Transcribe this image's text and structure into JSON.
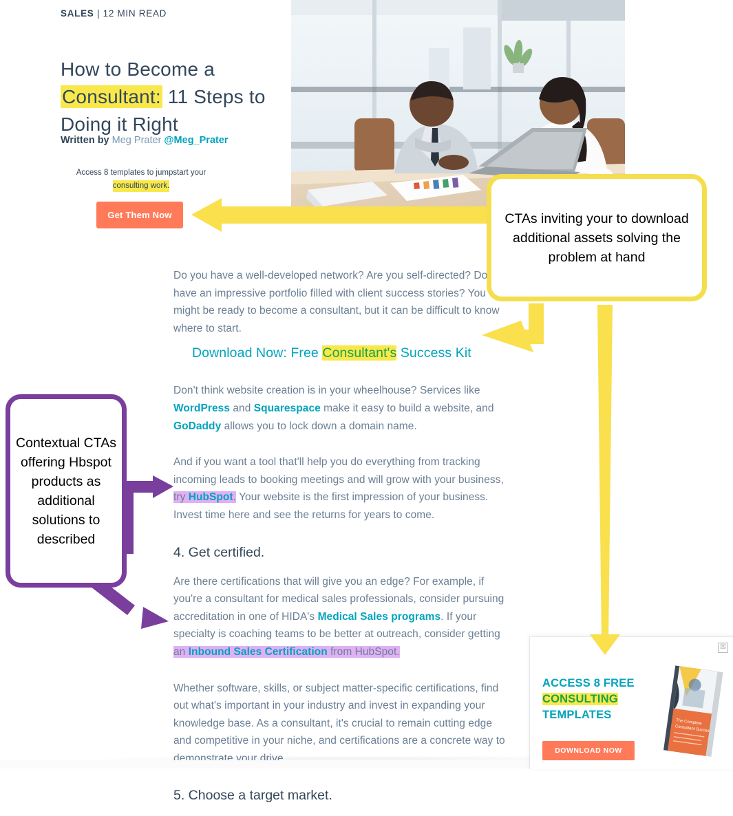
{
  "article": {
    "kicker_category": "SALES",
    "kicker_sep": " | ",
    "kicker_read": "12 MIN READ",
    "title_line1": "How to Become a",
    "title_highlight": "Consultant:",
    "title_line2_rest": " 11 Steps to",
    "title_line3": "Doing it Right",
    "byline_prefix": "Written by",
    "byline_author": "Meg Prater",
    "byline_handle": "@Meg_Prater"
  },
  "inline_cta": {
    "line1": "Access 8 templates to jumpstart your",
    "line2_highlighted": "consulting work.",
    "button_label": "Get Them Now"
  },
  "hero": {
    "alt": "Two business colleagues reviewing a laptop at a conference table in a bright office"
  },
  "body": {
    "p1": "Do you have a well-developed network? Are you self-directed? Do you have an impressive portfolio filled with client success stories? You might be ready to become a consultant, but it can be difficult to know where to start.",
    "cta_link_pre": "Download Now: Free ",
    "cta_link_highlight": "Consultant's",
    "cta_link_post": " Success Kit",
    "p2_a": "Don't think website creation is in your wheelhouse? Services like ",
    "p2_link1": "WordPress",
    "p2_b": " and ",
    "p2_link2": "Squarespace",
    "p2_c": " make it easy to build a website, and ",
    "p2_link3": "GoDaddy",
    "p2_d": " allows you to lock down a domain name.",
    "p3_a": "And if you want a tool that'll help you do everything from tracking incoming leads to booking meetings and will grow with your business, ",
    "p3_hl_pre": "try ",
    "p3_hl_link": "HubSpot",
    "p3_hl_post": ".",
    "p3_b": " Your website is the first impression of your business. Invest time here and see the returns for years to come.",
    "h4": "4. Get certified.",
    "p4_a": "Are there certifications that will give you an edge? For example, if you're a consultant for medical sales professionals, consider pursuing accreditation in one of HIDA's ",
    "p4_link1": "Medical Sales programs",
    "p4_b": ". If your specialty is coaching teams to be better at outreach, consider getting ",
    "p4_hl_pre": "an ",
    "p4_hl_link": "Inbound Sales Certification",
    "p4_hl_post": " from HubSpot.",
    "p5": "Whether software, skills, or subject matter-specific certifications, find out what's important in your industry and invest in expanding your knowledge base. As a consultant, it's crucial to remain cutting edge and competitive in your niche, and certifications are a concrete way to demonstrate your drive.",
    "h5": "5. Choose a target market."
  },
  "popup_cta": {
    "headline_line1": "ACCESS 8 FREE",
    "headline_line2_highlighted": "CONSULTING",
    "headline_line3": "TEMPLATES",
    "button_label": "DOWNLOAD NOW",
    "close_glyph": "☒",
    "ebook_title": "The Complete Consultant Success Kit"
  },
  "annotations": {
    "yellow_callout": "CTAs inviting your to download additional assets solving the problem at hand",
    "purple_callout": "Contextual CTAs offering Hbspot products as additional solutions to described"
  },
  "colors": {
    "hubspot_orange": "#ff7a59",
    "teal_link": "#00a4bd",
    "dark_slate": "#33475b",
    "body_gray": "#6a7f94",
    "highlight_yellow": "#f9e84c",
    "highlight_purple": "#e0b0f5",
    "annotation_yellow": "#f4de4e",
    "annotation_purple": "#7a3e9d",
    "green_text": "#16a34a"
  }
}
